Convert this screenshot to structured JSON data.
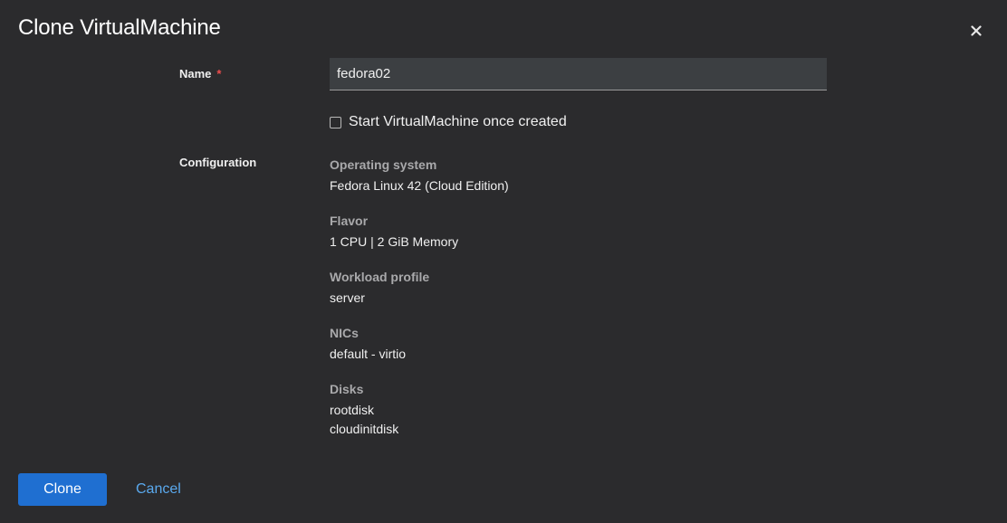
{
  "dialog": {
    "title": "Clone VirtualMachine"
  },
  "form": {
    "name_label": "Name",
    "required_marker": "*",
    "name_value": "fedora02",
    "start_checkbox_label": "Start VirtualMachine once created",
    "start_checked": false,
    "configuration_label": "Configuration"
  },
  "configuration": {
    "os": {
      "heading": "Operating system",
      "values": [
        "Fedora Linux 42 (Cloud Edition)"
      ]
    },
    "flavor": {
      "heading": "Flavor",
      "values": [
        "1 CPU | 2 GiB Memory"
      ]
    },
    "workload": {
      "heading": "Workload profile",
      "values": [
        "server"
      ]
    },
    "nics": {
      "heading": "NICs",
      "values": [
        "default - virtio"
      ]
    },
    "disks": {
      "heading": "Disks",
      "values": [
        "rootdisk",
        "cloudinitdisk"
      ]
    }
  },
  "footer": {
    "clone_label": "Clone",
    "cancel_label": "Cancel"
  },
  "icons": {
    "close": "close-icon"
  },
  "colors": {
    "primary": "#1f6fd1",
    "link": "#5aa9ee",
    "required": "#ee4d4d",
    "background": "#2b2b2d"
  }
}
